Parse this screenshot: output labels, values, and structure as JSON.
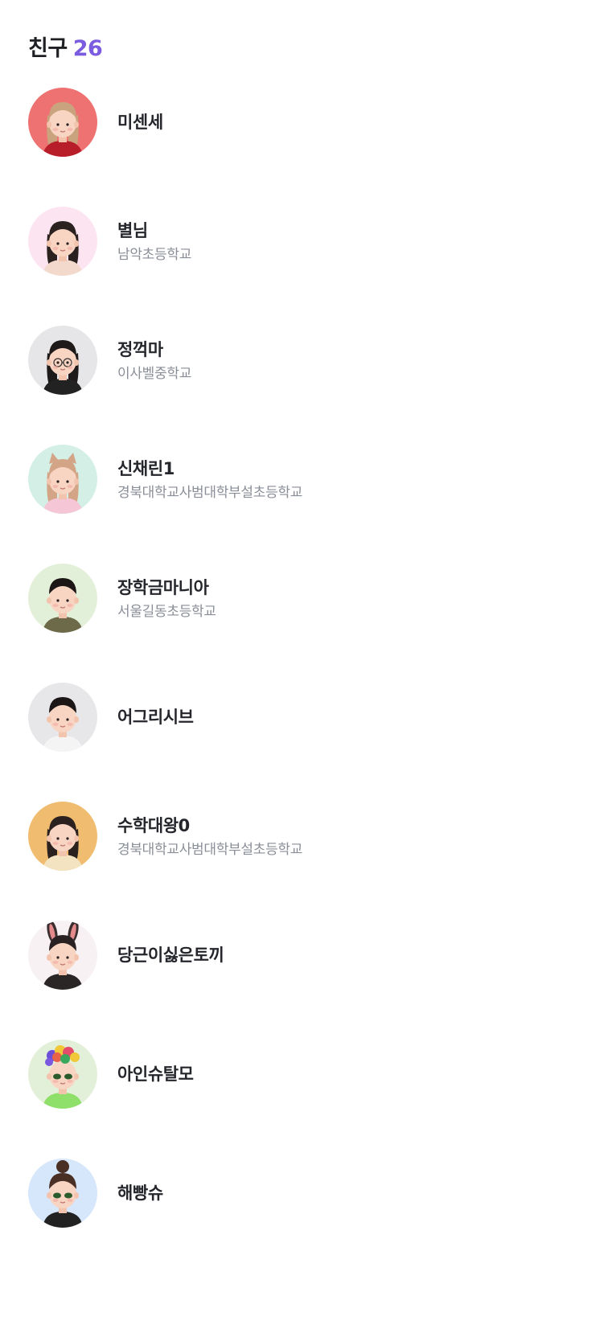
{
  "header": {
    "title": "친구",
    "count": "26"
  },
  "colors": {
    "accent": "#7b5ce0",
    "name_text": "#24262b",
    "school_text": "#8a8e97"
  },
  "friends": [
    {
      "name": "미센세",
      "school": "",
      "avatar_bg": "#ef7272",
      "hair": "#c9a37d",
      "shirt": "#b81d2a",
      "avatar_icon": "girl-avatar-icon"
    },
    {
      "name": "별님",
      "school": "남악초등학교",
      "avatar_bg": "#fde4f1",
      "hair": "#2b2220",
      "shirt": "#f3d9cc",
      "avatar_icon": "girl-avatar-icon"
    },
    {
      "name": "정꺽마",
      "school": "이사벨중학교",
      "avatar_bg": "#e6e6e8",
      "hair": "#1e1a1a",
      "shirt": "#222222",
      "avatar_icon": "glasses-avatar-icon"
    },
    {
      "name": "신채린1",
      "school": "경북대학교사범대학부설초등학교",
      "avatar_bg": "#d4efe6",
      "hair": "#d3a486",
      "shirt": "#f5c6d6",
      "avatar_icon": "cat-ears-avatar-icon"
    },
    {
      "name": "장학금마니아",
      "school": "서울길동초등학교",
      "avatar_bg": "#e3f0d9",
      "hair": "#1c1716",
      "shirt": "#6d6a4a",
      "avatar_icon": "boy-avatar-icon"
    },
    {
      "name": "어그리시브",
      "school": "",
      "avatar_bg": "#e7e7e9",
      "hair": "#1c1716",
      "shirt": "#f4f4f4",
      "avatar_icon": "boy-avatar-icon"
    },
    {
      "name": "수학대왕0",
      "school": "경북대학교사범대학부설초등학교",
      "avatar_bg": "#f0bc6f",
      "hair": "#2b2220",
      "shirt": "#f3e3c0",
      "avatar_icon": "girl-avatar-icon"
    },
    {
      "name": "당근이싫은토끼",
      "school": "",
      "avatar_bg": "#f7f1f4",
      "hair": "#2a2222",
      "shirt": "#2b2626",
      "avatar_icon": "bunny-ears-avatar-icon"
    },
    {
      "name": "아인슈탈모",
      "school": "",
      "avatar_bg": "#e3f0d9",
      "hair": "#e44c6c",
      "shirt": "#8fe06a",
      "avatar_icon": "balloon-hair-avatar-icon"
    },
    {
      "name": "해빵슈",
      "school": "",
      "avatar_bg": "#d6e6fb",
      "hair": "#4a2f25",
      "shirt": "#222222",
      "avatar_icon": "bun-hair-avatar-icon"
    }
  ]
}
